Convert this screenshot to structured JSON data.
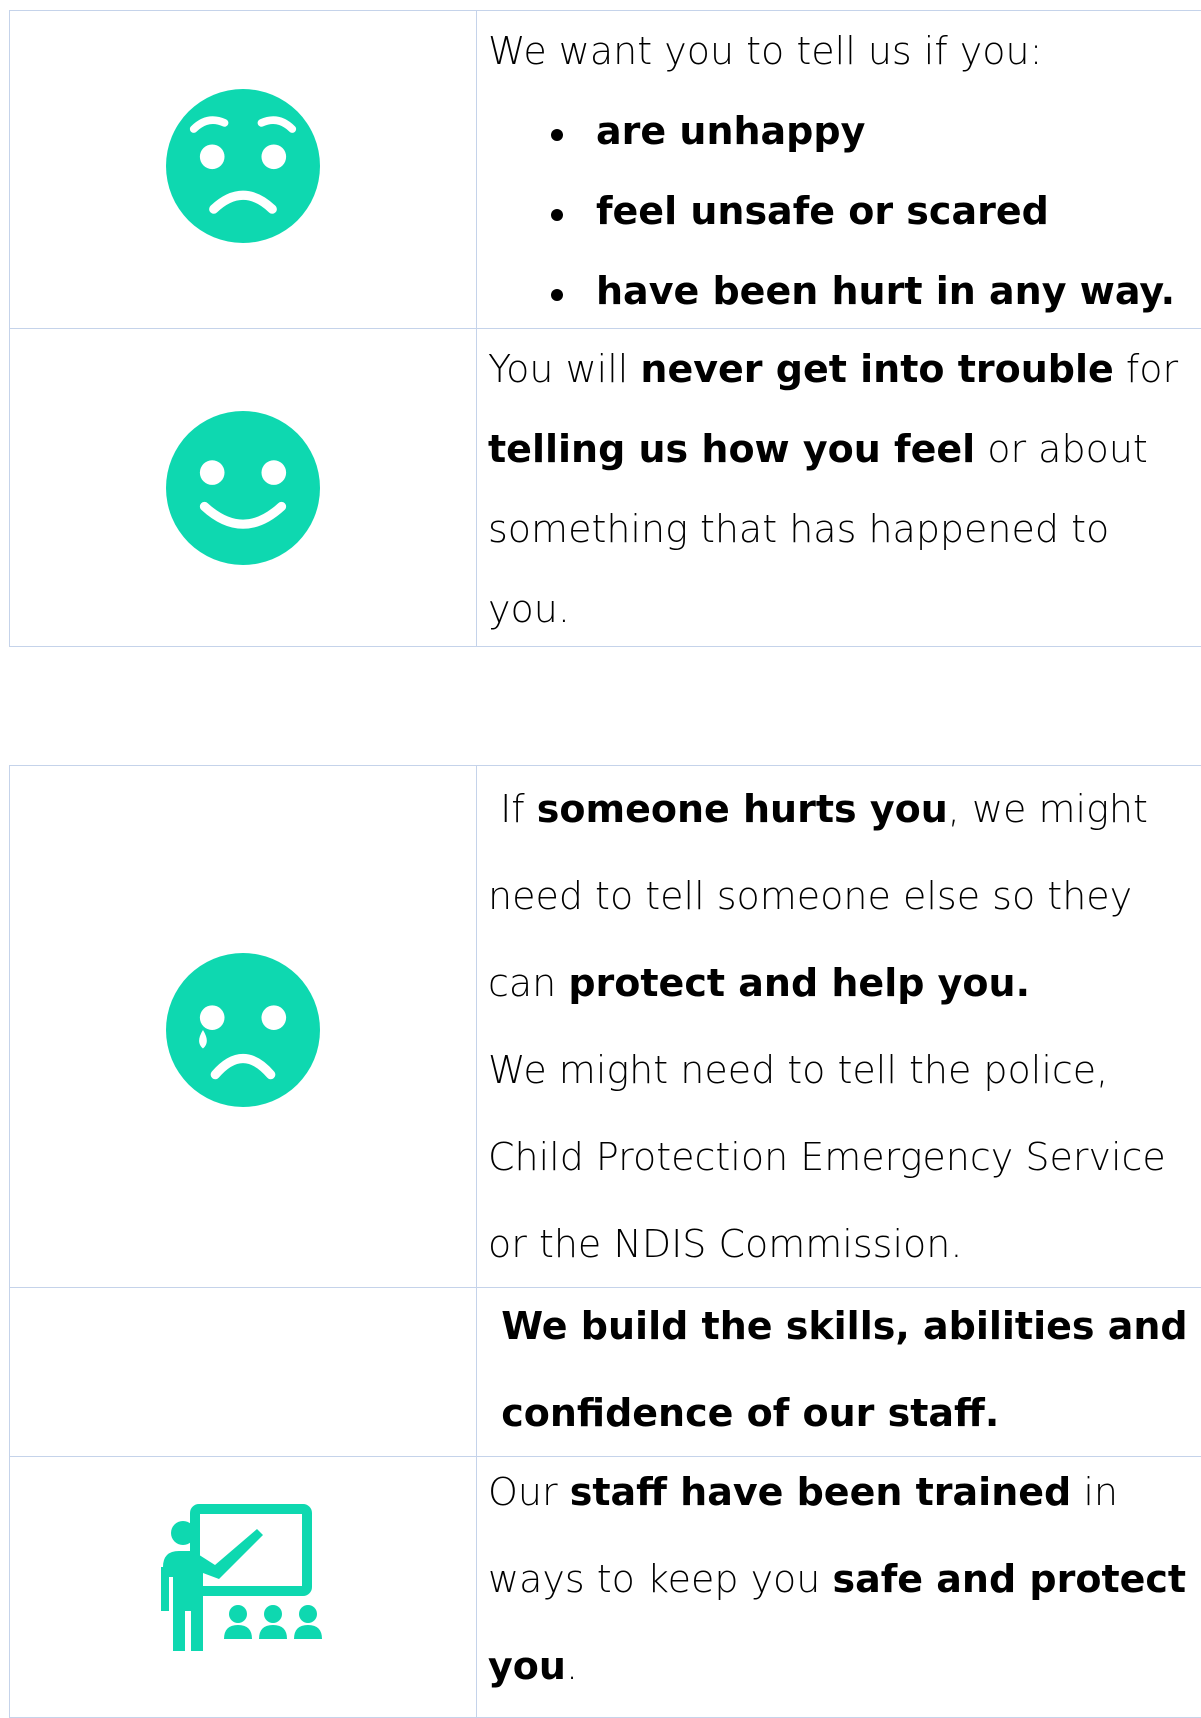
{
  "accent_color": "#0ed8b0",
  "table1": {
    "row1": {
      "icon": "worried-face-icon",
      "intro": "We want you to tell us if you:",
      "bullets": [
        "are unhappy",
        "feel unsafe or scared",
        "have been hurt in any way."
      ]
    },
    "row2": {
      "icon": "smiling-face-icon",
      "p1": "You will ",
      "b1": "never get into trouble",
      "p2": " for",
      "b2": "telling us how you feel",
      "p3": " or about",
      "line3": "something that has happened to",
      "line4": "you."
    }
  },
  "table2": {
    "row1": {
      "icon": "crying-face-icon",
      "p1": " If ",
      "b1": "someone hurts you",
      "p2": ", we might",
      "line2": "need to tell someone else so they",
      "p3": "can ",
      "b2": "protect and help you.",
      "line4": "We might need to tell the police,",
      "line5": "Child Protection Emergency Service",
      "line6": "or the NDIS Commission."
    },
    "row2": {
      "line1": " We build the skills, abilities and",
      "line2": " confidence of our staff."
    },
    "row3": {
      "icon": "teacher-training-icon",
      "p1": "Our ",
      "b1": "staff have been trained",
      "p2": " in",
      "p3": "ways to keep you ",
      "b2": "safe and protect",
      "b3": "you",
      "p4": "."
    }
  }
}
